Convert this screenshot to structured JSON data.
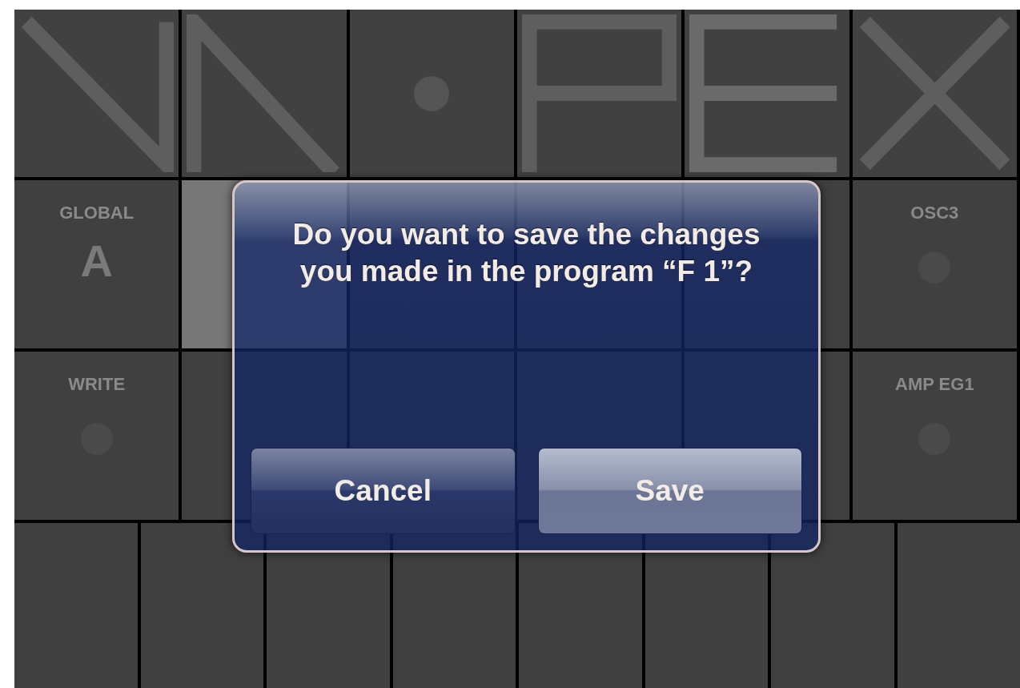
{
  "pad_rows": [
    [
      {
        "label": "GLOBAL",
        "value": "A",
        "selected": false
      },
      {
        "selected": true
      },
      {
        "selected": false
      },
      {
        "selected": false
      },
      {
        "selected": false
      },
      {
        "label": "OSC3",
        "selected": false
      }
    ],
    [
      {
        "label": "WRITE",
        "selected": false
      },
      {
        "selected": false
      },
      {
        "selected": false
      },
      {
        "selected": false
      },
      {
        "selected": false
      },
      {
        "label": "AMP EG1",
        "selected": false
      }
    ]
  ],
  "dialog": {
    "message": "Do you want to save the changes you made in the program “F 1”?",
    "buttons": [
      {
        "label": "Cancel",
        "kind": "secondary"
      },
      {
        "label": "Save",
        "kind": "primary"
      }
    ]
  }
}
